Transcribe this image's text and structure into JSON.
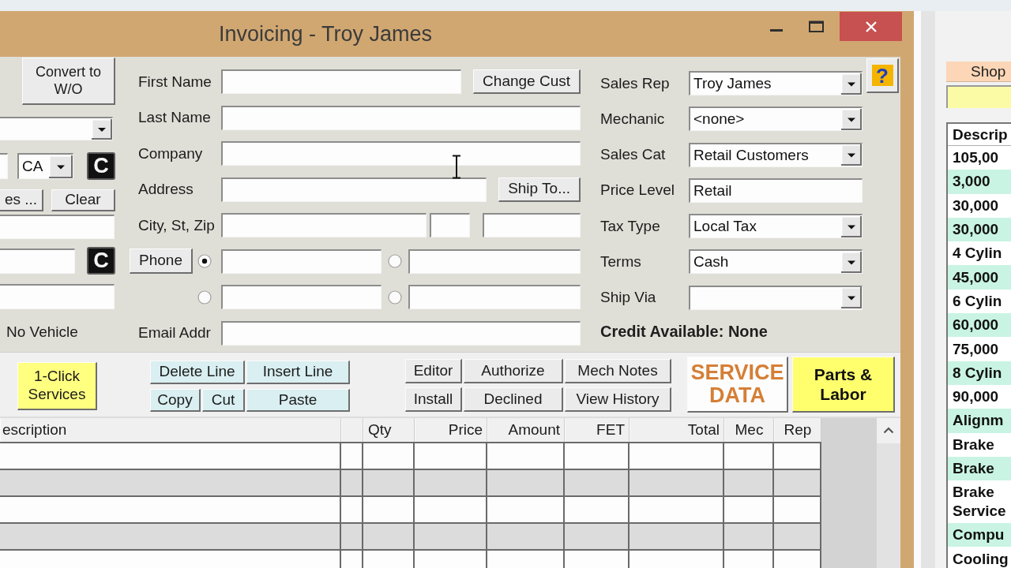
{
  "window": {
    "title": "Invoicing - Troy James"
  },
  "vehicle_panel": {
    "convert_button": "Convert to W/O",
    "state": "CA",
    "letter_buttons": [
      "C",
      "C"
    ],
    "buttons": [
      "es ...",
      "Clear"
    ],
    "vehicle": "No Vehicle"
  },
  "customer_form": {
    "rows": [
      {
        "kind": "field",
        "label": "First Name",
        "button": "Change Cust"
      },
      {
        "kind": "field",
        "label": "Last Name"
      },
      {
        "kind": "field",
        "label": "Company"
      },
      {
        "kind": "field",
        "label": "Address",
        "button": "Ship To..."
      },
      {
        "kind": "city",
        "label": "City, St, Zip"
      },
      {
        "kind": "phone",
        "button": "Phone",
        "radios": [
          {
            "selected": true
          },
          {
            "selected": false
          }
        ]
      },
      {
        "kind": "phone",
        "radios": [
          {
            "selected": false
          },
          {
            "selected": false
          }
        ]
      },
      {
        "kind": "field",
        "label": "Email Addr"
      }
    ]
  },
  "sales_form": {
    "rows": [
      {
        "kind": "dropdown",
        "label": "Sales Rep",
        "value": "Troy James"
      },
      {
        "kind": "dropdown",
        "label": "Mechanic",
        "value": "<none>"
      },
      {
        "kind": "dropdown",
        "label": "Sales Cat",
        "value": "Retail Customers"
      },
      {
        "kind": "text",
        "label": "Price Level",
        "value": "Retail"
      },
      {
        "kind": "dropdown",
        "label": "Tax Type",
        "value": "Local Tax"
      },
      {
        "kind": "dropdown",
        "label": "Terms",
        "value": "Cash"
      },
      {
        "kind": "dropdown",
        "label": "Ship Via"
      }
    ],
    "credit": "Credit Available: None"
  },
  "help_button": "?",
  "toolbar": {
    "services_button": "1-Click Services",
    "edit_buttons": [
      [
        "Delete Line",
        "Insert Line"
      ],
      [
        "Copy",
        "Cut",
        "Paste"
      ]
    ],
    "action_buttons": [
      [
        "Editor",
        "Authorize",
        "Mech Notes"
      ],
      [
        "Install",
        "Declined",
        "View History"
      ]
    ],
    "service_data_button": "SERVICE DATA",
    "parts_button": "Parts & Labor"
  },
  "table": {
    "columns": [
      "escription",
      "Qty",
      "Price",
      "Amount",
      "FET",
      "Total",
      "Mec",
      "Rep"
    ]
  },
  "shop_panel": {
    "button": "Shop",
    "list": {
      "header": "Descrip",
      "items": [
        "105,00",
        "3,000",
        "30,000",
        "30,000",
        "4 Cylin",
        "45,000",
        "6 Cylin",
        "60,000",
        "75,000",
        "8 Cylin",
        "90,000",
        "Alignm",
        "Brake",
        "Brake",
        "Brake Service",
        "Compu",
        "Cooling"
      ]
    }
  }
}
